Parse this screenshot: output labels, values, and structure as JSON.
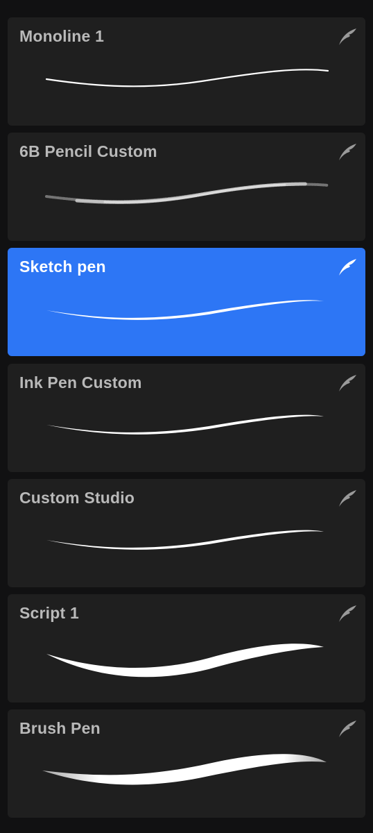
{
  "colors": {
    "background": "#111112",
    "card": "#1f1f1f",
    "card_selected": "#2d76f5",
    "label": "#b9b9b9",
    "label_selected": "#ffffff",
    "icon": "#9a9a9a",
    "stroke": "#ffffff"
  },
  "brushes": [
    {
      "name": "Monoline 1",
      "selected": false,
      "icon": "brush-feather-icon",
      "stroke_style": "monoline"
    },
    {
      "name": "6B Pencil Custom",
      "selected": false,
      "icon": "brush-feather-icon",
      "stroke_style": "grainy-pencil"
    },
    {
      "name": "Sketch pen",
      "selected": true,
      "icon": "brush-feather-icon",
      "stroke_style": "tapered-thin"
    },
    {
      "name": "Ink Pen Custom",
      "selected": false,
      "icon": "brush-feather-icon",
      "stroke_style": "tapered-thin"
    },
    {
      "name": "Custom Studio",
      "selected": false,
      "icon": "brush-feather-icon",
      "stroke_style": "tapered-thin"
    },
    {
      "name": "Script 1",
      "selected": false,
      "icon": "brush-feather-icon",
      "stroke_style": "tapered-thick"
    },
    {
      "name": "Brush Pen",
      "selected": false,
      "icon": "brush-feather-icon",
      "stroke_style": "brush-thick"
    }
  ]
}
